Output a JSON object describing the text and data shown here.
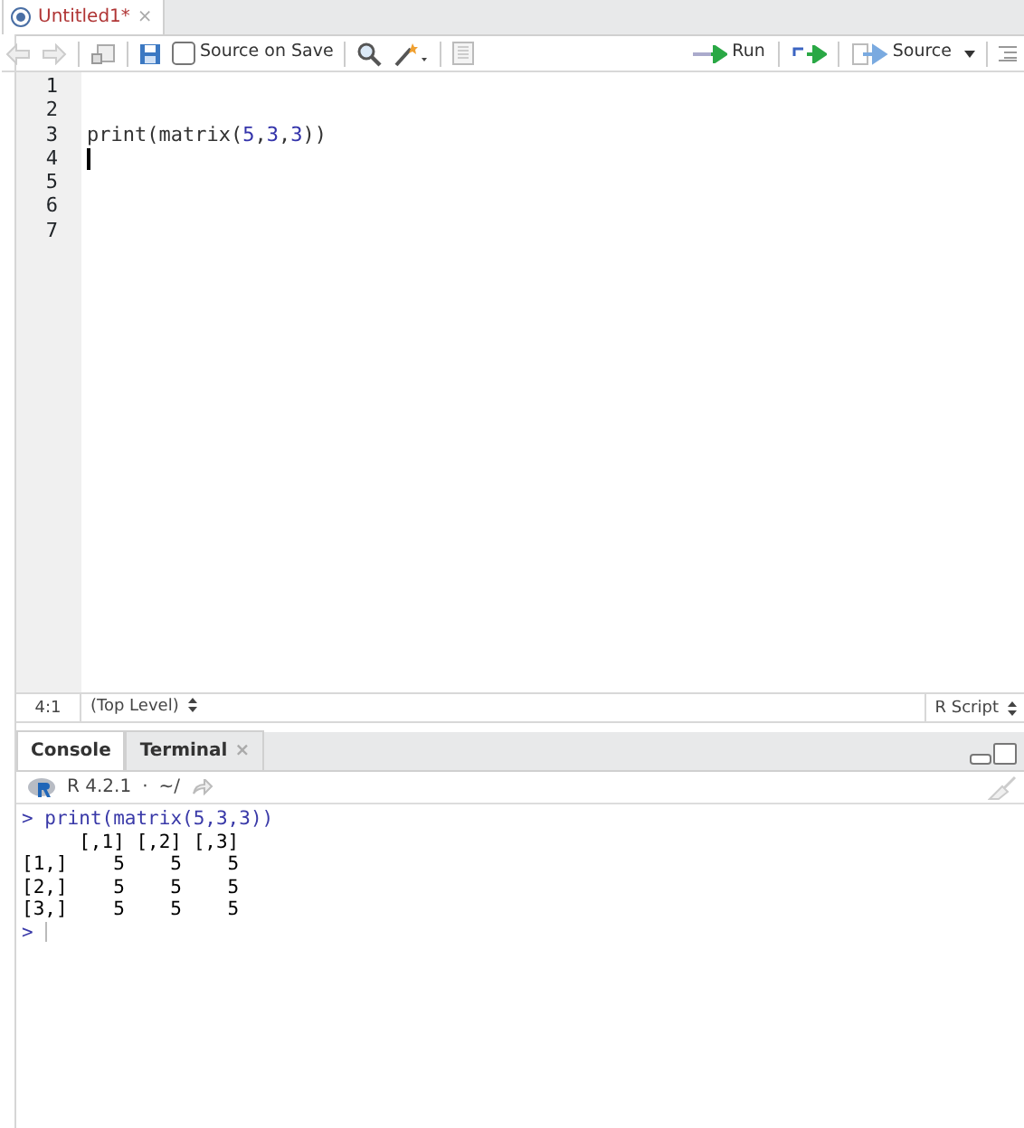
{
  "editor": {
    "tabs": [
      {
        "label": "Untitled1*",
        "selected": true,
        "close_glyph": "×"
      }
    ],
    "toolbar": {
      "source_on_save": {
        "label": "Source on Save",
        "checked": false
      },
      "run": "Run",
      "source": "Source"
    },
    "lines": [
      {
        "number": "1",
        "cursor": false
      },
      {
        "number": "2",
        "cursor": false
      },
      {
        "number": "3",
        "tokens": [
          {
            "kind": "plain",
            "text": "print(matrix("
          },
          {
            "kind": "number",
            "text": "5"
          },
          {
            "kind": "plain",
            "text": ","
          },
          {
            "kind": "number",
            "text": "3"
          },
          {
            "kind": "plain",
            "text": ","
          },
          {
            "kind": "number",
            "text": "3"
          },
          {
            "kind": "plain",
            "text": "))"
          }
        ],
        "cursor": false
      },
      {
        "number": "4",
        "cursor": true
      },
      {
        "number": "5",
        "cursor": false
      },
      {
        "number": "6",
        "cursor": false
      },
      {
        "number": "7",
        "cursor": false
      }
    ],
    "status_bar": {
      "position": "4:1",
      "scope": "(Top Level)",
      "file_type": "R Script"
    }
  },
  "console": {
    "tabs": [
      {
        "label": "Console",
        "selected": true,
        "closable": false
      },
      {
        "label": "Terminal",
        "selected": false,
        "closable": true,
        "close_glyph": "×"
      }
    ],
    "version": "R 4.2.1",
    "separator": "·",
    "path": "~/",
    "lines": [
      {
        "kind": "input",
        "prompt": ">",
        "text": "print(matrix(5,3,3))"
      },
      {
        "kind": "output",
        "text": "     [,1] [,2] [,3]"
      },
      {
        "kind": "output",
        "text": "[1,]    5    5    5"
      },
      {
        "kind": "output",
        "text": "[2,]    5    5    5"
      },
      {
        "kind": "output",
        "text": "[3,]    5    5    5"
      },
      {
        "kind": "prompt",
        "prompt": ">"
      }
    ]
  }
}
